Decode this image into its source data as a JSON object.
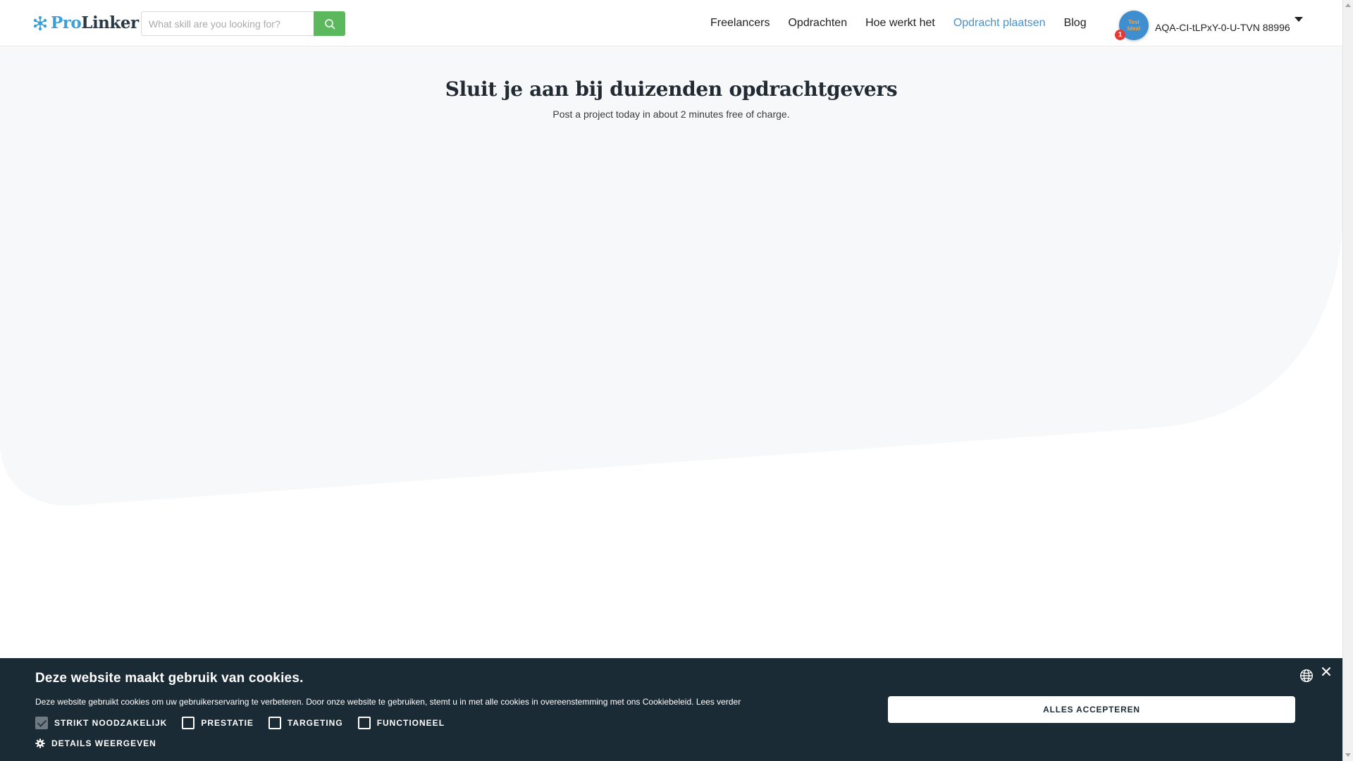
{
  "brand": {
    "name_part1": "Pro",
    "name_part2": "Linker",
    "colors": {
      "pro": "#3d9fd7",
      "linker": "#2b3a47"
    }
  },
  "search": {
    "placeholder": "What skill are you looking for?",
    "value": "",
    "button_icon": "search-icon",
    "button_color": "#5cb85c"
  },
  "nav": {
    "items": [
      {
        "label": "Freelancers",
        "active": false
      },
      {
        "label": "Opdrachten",
        "active": false
      },
      {
        "label": "Hoe werkt het",
        "active": false
      },
      {
        "label": "Opdracht plaatsen",
        "active": true
      },
      {
        "label": "Blog",
        "active": false
      }
    ],
    "active_color": "#4a90c8"
  },
  "user": {
    "avatar_text": "Test Ideal",
    "notification_count": "1",
    "name": "AQA-CI-tLPxY-0-U-TVN 88996",
    "menu_icon": "caret-down-icon"
  },
  "hero": {
    "title": "Sluit je aan bij duizenden opdrachtgevers",
    "subtitle": "Post a project today in about 2 minutes free of charge.",
    "background_color": "#f7f8fa"
  },
  "cookie_banner": {
    "title": "Deze website maakt gebruik van cookies.",
    "text": "Deze website gebruikt cookies om uw gebruikerservaring te verbeteren. Door onze website te gebruiken, stemt u in met alle cookies in overeenstemming met ons Cookiebeleid.",
    "read_more": "Lees verder",
    "options": [
      {
        "label": "STRIKT NOODZAKELIJK",
        "checked": true
      },
      {
        "label": "PRESTATIE",
        "checked": false
      },
      {
        "label": "TARGETING",
        "checked": false
      },
      {
        "label": "FUNCTIONEEL",
        "checked": false
      }
    ],
    "details_label": "DETAILS WEERGEVEN",
    "accept_label": "ALLES ACCEPTEREN",
    "background_color": "#1b2b36"
  }
}
